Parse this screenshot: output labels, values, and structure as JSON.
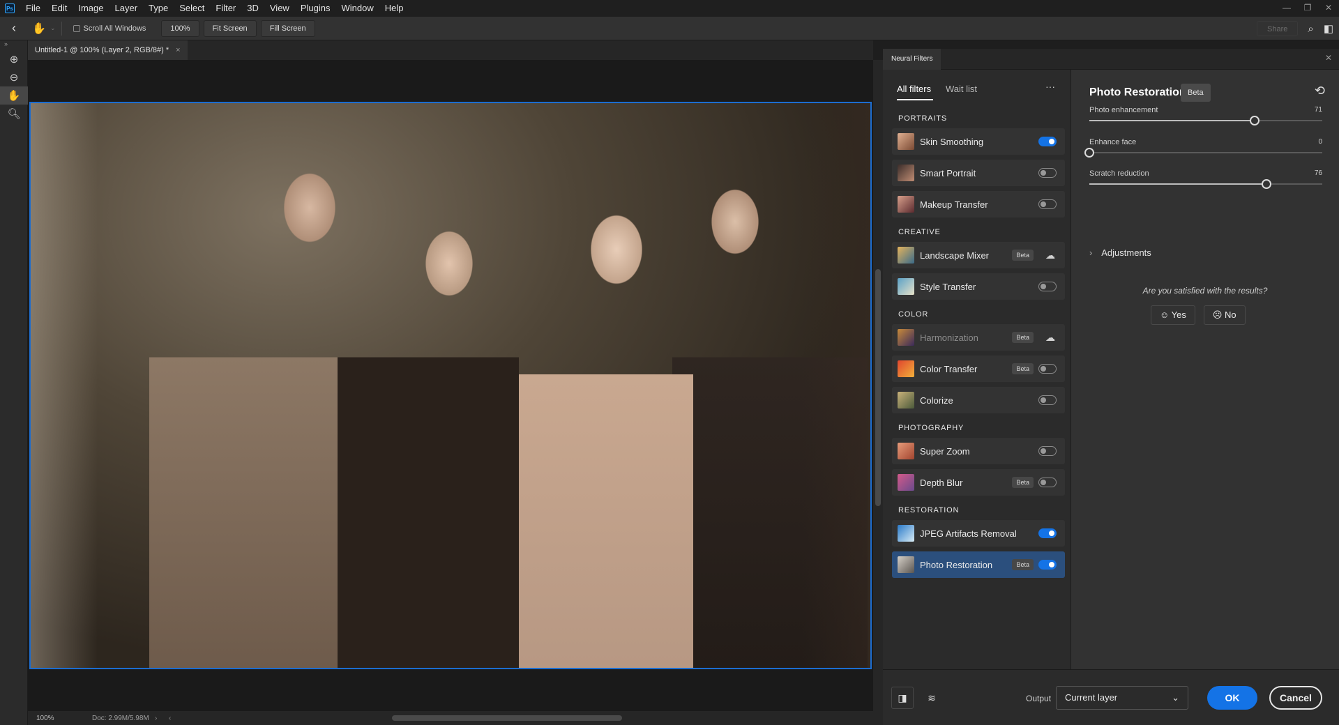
{
  "app": {
    "logo": "Ps"
  },
  "menu": [
    "File",
    "Edit",
    "Image",
    "Layer",
    "Type",
    "Select",
    "Filter",
    "3D",
    "View",
    "Plugins",
    "Window",
    "Help"
  ],
  "options_bar": {
    "scroll_all_windows": "Scroll All Windows",
    "zoom_btn": "100%",
    "fit_screen": "Fit Screen",
    "fill_screen": "Fill Screen",
    "share": "Share"
  },
  "document": {
    "tab_title": "Untitled-1 @ 100% (Layer 2, RGB/8#) *",
    "tab_close": "×",
    "zoom": "100%",
    "doc_info": "Doc: 2.99M/5.98M"
  },
  "neural_filters": {
    "panel_tab": "Neural Filters",
    "tabs": {
      "all": "All filters",
      "wait": "Wait list",
      "more": "···"
    },
    "sections": [
      {
        "title": "PORTRAITS",
        "items": [
          {
            "label": "Skin Smoothing",
            "beta": "",
            "control": "toggle",
            "on": true,
            "dim": false,
            "colors": [
              "#e0b092",
              "#7b4a33"
            ]
          },
          {
            "label": "Smart Portrait",
            "beta": "",
            "control": "toggle",
            "on": false,
            "dim": false,
            "colors": [
              "#3b2d2a",
              "#c08d74"
            ]
          },
          {
            "label": "Makeup Transfer",
            "beta": "",
            "control": "toggle",
            "on": false,
            "dim": false,
            "colors": [
              "#d8a08c",
              "#5b2a2e"
            ]
          }
        ]
      },
      {
        "title": "CREATIVE",
        "items": [
          {
            "label": "Landscape Mixer",
            "beta": "Beta",
            "control": "cloud",
            "on": false,
            "dim": false,
            "colors": [
              "#e4b35c",
              "#3a6b8a"
            ]
          },
          {
            "label": "Style Transfer",
            "beta": "",
            "control": "toggle",
            "on": false,
            "dim": false,
            "colors": [
              "#5aa1c7",
              "#e8e2c8"
            ]
          }
        ]
      },
      {
        "title": "COLOR",
        "items": [
          {
            "label": "Harmonization",
            "beta": "Beta",
            "control": "cloud",
            "on": false,
            "dim": true,
            "colors": [
              "#c88a3a",
              "#3a2a5a"
            ]
          },
          {
            "label": "Color Transfer",
            "beta": "Beta",
            "control": "toggle",
            "on": false,
            "dim": false,
            "colors": [
              "#e0462e",
              "#f2b03a"
            ]
          },
          {
            "label": "Colorize",
            "beta": "",
            "control": "toggle",
            "on": false,
            "dim": false,
            "colors": [
              "#c9b27a",
              "#4b5a3a"
            ]
          }
        ]
      },
      {
        "title": "PHOTOGRAPHY",
        "items": [
          {
            "label": "Super Zoom",
            "beta": "",
            "control": "toggle",
            "on": false,
            "dim": false,
            "colors": [
              "#e79b7a",
              "#a2452f"
            ]
          },
          {
            "label": "Depth Blur",
            "beta": "Beta",
            "control": "toggle",
            "on": false,
            "dim": false,
            "colors": [
              "#d35a8a",
              "#6a4a8c"
            ]
          }
        ]
      },
      {
        "title": "RESTORATION",
        "items": [
          {
            "label": "JPEG Artifacts Removal",
            "beta": "",
            "control": "toggle",
            "on": true,
            "dim": false,
            "colors": [
              "#2a7ac9",
              "#d8ecf5"
            ]
          },
          {
            "label": "Photo Restoration",
            "beta": "Beta",
            "control": "toggle",
            "on": true,
            "dim": false,
            "selected": true,
            "colors": [
              "#d6d0c8",
              "#5a5550"
            ]
          }
        ]
      }
    ],
    "detail": {
      "title": "Photo Restoration",
      "beta": "Beta",
      "sliders": [
        {
          "label": "Photo enhancement",
          "value": "71",
          "fraction": 0.71
        },
        {
          "label": "Enhance face",
          "value": "0",
          "fraction": 0.0
        },
        {
          "label": "Scratch reduction",
          "value": "76",
          "fraction": 0.76
        }
      ],
      "adjustments": "Adjustments",
      "question": "Are you satisfied with the results?",
      "yes": "Yes",
      "no": "No"
    },
    "bottom": {
      "output_label": "Output",
      "output_value": "Current layer",
      "ok": "OK",
      "cancel": "Cancel"
    }
  }
}
